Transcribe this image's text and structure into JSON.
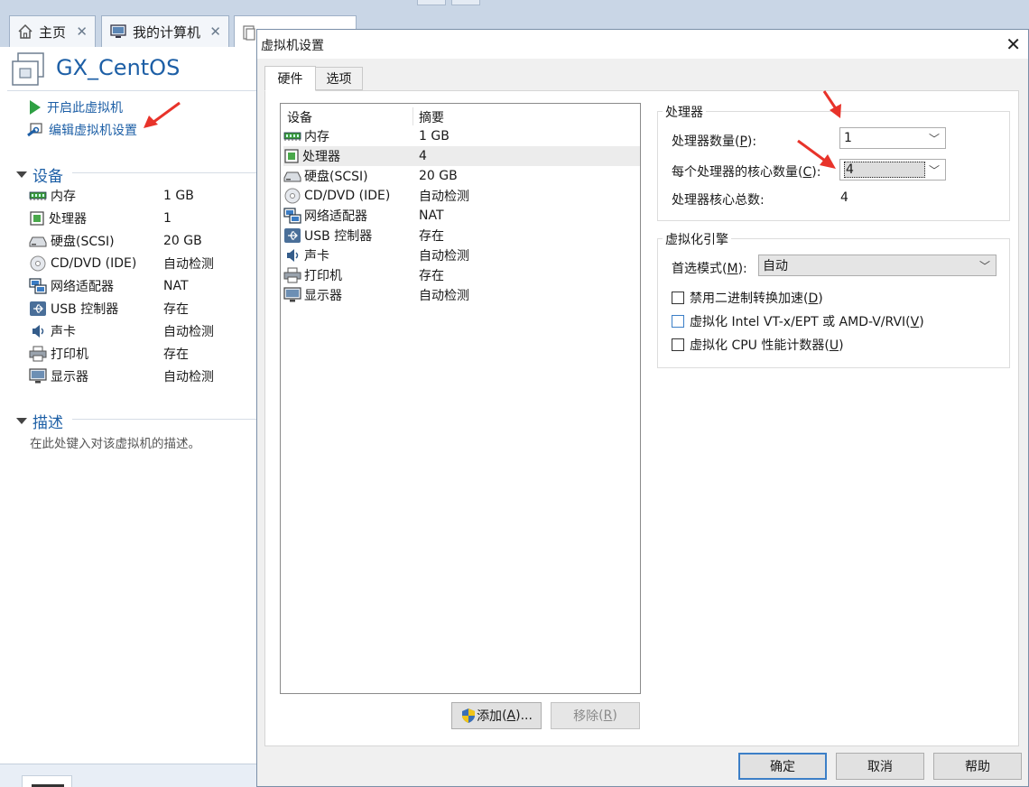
{
  "tabs": [
    {
      "label": "主页",
      "icon": "home-icon"
    },
    {
      "label": "我的计算机",
      "icon": "computer-icon"
    },
    {
      "label": "",
      "icon": "document-icon"
    }
  ],
  "left": {
    "vm_name": "GX_CentOS",
    "actions": [
      {
        "label": "开启此虚拟机",
        "icon": "play-icon"
      },
      {
        "label": "编辑虚拟机设置",
        "icon": "settings-icon"
      }
    ],
    "devices_header": "设备",
    "devices": [
      {
        "name": "内存",
        "value": "1 GB",
        "icon": "memory-icon"
      },
      {
        "name": "处理器",
        "value": "1",
        "icon": "processor-icon"
      },
      {
        "name": "硬盘(SCSI)",
        "value": "20 GB",
        "icon": "harddisk-icon"
      },
      {
        "name": "CD/DVD (IDE)",
        "value": "自动检测",
        "icon": "cdrom-icon"
      },
      {
        "name": "网络适配器",
        "value": "NAT",
        "icon": "network-icon"
      },
      {
        "name": "USB 控制器",
        "value": "存在",
        "icon": "usb-icon"
      },
      {
        "name": "声卡",
        "value": "自动检测",
        "icon": "sound-icon"
      },
      {
        "name": "打印机",
        "value": "存在",
        "icon": "printer-icon"
      },
      {
        "name": "显示器",
        "value": "自动检测",
        "icon": "display-icon"
      }
    ],
    "description_header": "描述",
    "description_placeholder": "在此处键入对该虚拟机的描述。"
  },
  "dialog": {
    "title": "虚拟机设置",
    "tabs": [
      "硬件",
      "选项"
    ],
    "list_headers": {
      "device": "设备",
      "summary": "摘要"
    },
    "list": [
      {
        "name": "内存",
        "value": "1 GB",
        "icon": "memory-icon"
      },
      {
        "name": "处理器",
        "value": "4",
        "icon": "processor-icon"
      },
      {
        "name": "硬盘(SCSI)",
        "value": "20 GB",
        "icon": "harddisk-icon"
      },
      {
        "name": "CD/DVD (IDE)",
        "value": "自动检测",
        "icon": "cdrom-icon"
      },
      {
        "name": "网络适配器",
        "value": "NAT",
        "icon": "network-icon"
      },
      {
        "name": "USB 控制器",
        "value": "存在",
        "icon": "usb-icon"
      },
      {
        "name": "声卡",
        "value": "自动检测",
        "icon": "sound-icon"
      },
      {
        "name": "打印机",
        "value": "存在",
        "icon": "printer-icon"
      },
      {
        "name": "显示器",
        "value": "自动检测",
        "icon": "display-icon"
      }
    ],
    "add_button": {
      "label": "添加",
      "key": "A",
      "suffix": "..."
    },
    "remove_button": {
      "label": "移除",
      "key": "R"
    },
    "processor": {
      "group_label": "处理器",
      "count_label": "处理器数量(",
      "count_key": "P",
      "count_value": "1",
      "cores_label": "每个处理器的核心数量(",
      "cores_key": "C",
      "cores_value": "4",
      "total_label": "处理器核心总数:",
      "total_value": "4"
    },
    "engine": {
      "group_label": "虚拟化引擎",
      "mode_label": "首选模式(",
      "mode_key": "M",
      "mode_value": "自动",
      "options": [
        {
          "label": "禁用二进制转换加速(",
          "key": "D",
          "checked": false
        },
        {
          "label": "虚拟化 Intel VT-x/EPT 或 AMD-V/RVI(",
          "key": "V",
          "checked": false
        },
        {
          "label": "虚拟化 CPU 性能计数器(",
          "key": "U",
          "checked": false
        }
      ]
    },
    "ok_label": "确定",
    "cancel_label": "取消",
    "help_label": "帮助"
  },
  "colors": {
    "accent": "#1d5fa6",
    "arrow": "#e8332a"
  }
}
